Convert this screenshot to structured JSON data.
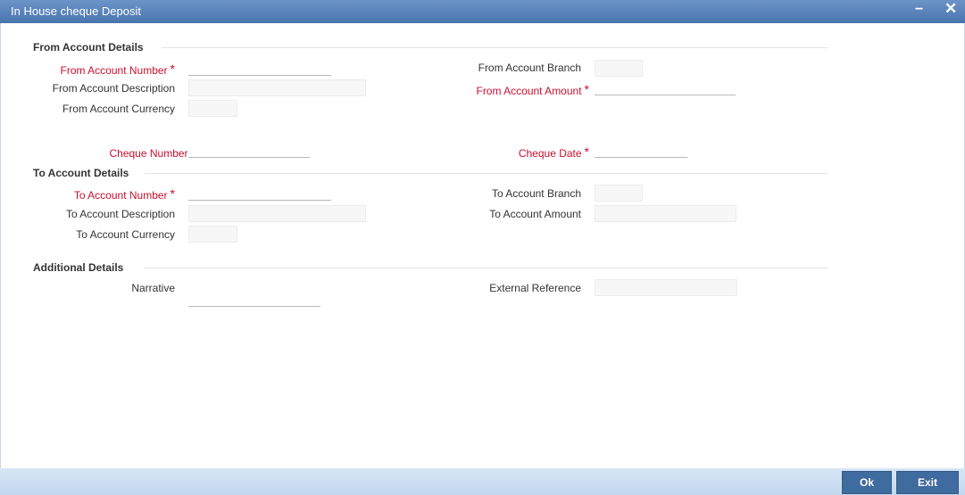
{
  "window": {
    "title": "In House cheque Deposit",
    "minimize_glyph": "−",
    "close_glyph": "✕"
  },
  "from_section": {
    "title": "From Account Details",
    "account_number_label": "From Account Number",
    "account_description_label": "From Account Description",
    "account_currency_label": "From Account Currency",
    "account_branch_label": "From Account Branch",
    "account_amount_label": "From Account Amount"
  },
  "cheque": {
    "number_label": "Cheque Number",
    "date_label": "Cheque Date"
  },
  "to_section": {
    "title": "To Account Details",
    "account_number_label": "To Account Number",
    "account_description_label": "To Account Description",
    "account_currency_label": "To Account Currency",
    "account_branch_label": "To Account Branch",
    "account_amount_label": "To Account Amount"
  },
  "additional_section": {
    "title": "Additional Details",
    "narrative_label": "Narrative",
    "external_reference_label": "External Reference"
  },
  "required_marker": "*",
  "footer": {
    "ok_label": "Ok",
    "exit_label": "Exit"
  },
  "colors": {
    "titlebar": "#4f7ab3",
    "required": "#c8102e",
    "button": "#3f6b9f",
    "footer": "#c9dcf0"
  }
}
